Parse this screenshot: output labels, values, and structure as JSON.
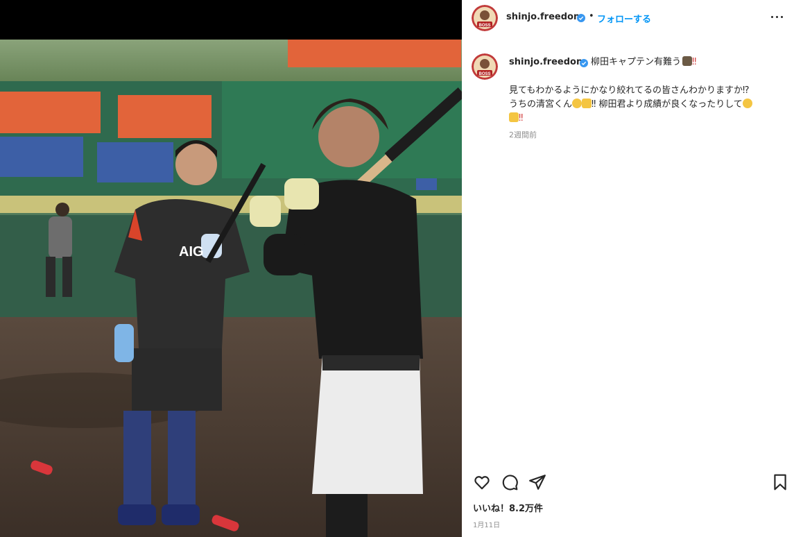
{
  "post": {
    "username": "shinjo.freedom",
    "separator": "•",
    "follow_label": "フォローする",
    "avatar_text": "BOSS"
  },
  "caption": {
    "username": "shinjo.freedom",
    "first_line": "柳田キャプテン有難う",
    "exclaim1": "‼",
    "line2": "見てもわかるようにかなり絞れてるの皆さんわかりますか⁉",
    "line3a": "うちの清宮くん",
    "line3b": "‼ 柳田君より成績が良くなったりして",
    "line4": "‼",
    "time_ago": "2週間前"
  },
  "actions": {
    "like": "heart-icon",
    "comment": "comment-icon",
    "share": "paper-plane-icon",
    "save": "bookmark-icon"
  },
  "likes_text": "いいね！8.2万件",
  "date_text": "1月11日",
  "photo_jersey_text": "AIG",
  "colors": {
    "follow": "#0095f6",
    "text": "#262626",
    "muted": "#8e8e8e",
    "verified": "#3897f0"
  }
}
